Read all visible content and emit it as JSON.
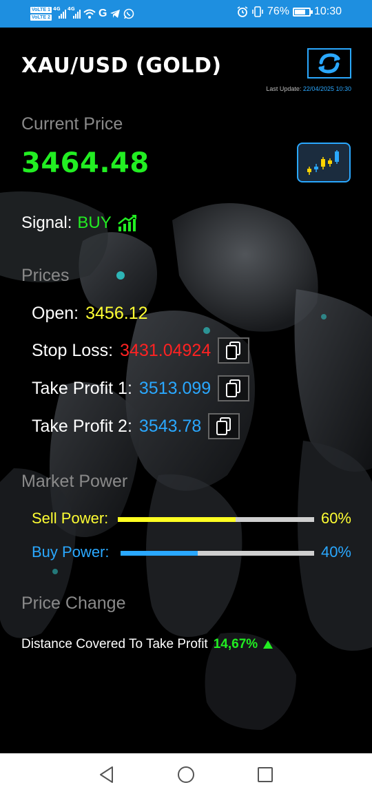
{
  "status_bar": {
    "sim1_tag": "VoLTE 1",
    "sim2_tag": "VoLTE 2",
    "network1": "4G",
    "network2": "4G",
    "carrier_g": "G",
    "battery_percent": "76%",
    "battery_level": 0.76,
    "time": "10:30",
    "icons": [
      "signal-icon",
      "signal-icon",
      "wifi-icon",
      "telegram-icon",
      "whatsapp-icon",
      "alarm-icon",
      "vibrate-icon",
      "battery-icon"
    ]
  },
  "header": {
    "title": "XAU/USD (GOLD)",
    "last_update_label": "Last Update:",
    "last_update_value": "22/04/2025 10:30"
  },
  "current_price": {
    "label": "Current Price",
    "value": "3464.48"
  },
  "signal": {
    "label": "Signal:",
    "value": "BUY"
  },
  "prices": {
    "label": "Prices",
    "open_label": "Open:",
    "open_value": "3456.12",
    "stop_loss_label": "Stop Loss:",
    "stop_loss_value": "3431.04924",
    "tp1_label": "Take Profit 1:",
    "tp1_value": "3513.099",
    "tp2_label": "Take Profit 2:",
    "tp2_value": "3543.78"
  },
  "market_power": {
    "label": "Market Power",
    "sell_label": "Sell Power:",
    "sell_percent": "60%",
    "sell_level": 0.6,
    "buy_label": "Buy Power:",
    "buy_percent": "40%",
    "buy_level": 0.4
  },
  "price_change": {
    "label": "Price Change",
    "distance_label": "Distance Covered To Take Profit",
    "distance_value": "14,67%"
  },
  "colors": {
    "status_bar": "#1e8fe0",
    "accent_blue": "#2aa8ff",
    "price_green": "#22ee22",
    "open_yellow": "#ffff33",
    "stop_red": "#ff2222",
    "muted_label": "#8a8a8a"
  }
}
